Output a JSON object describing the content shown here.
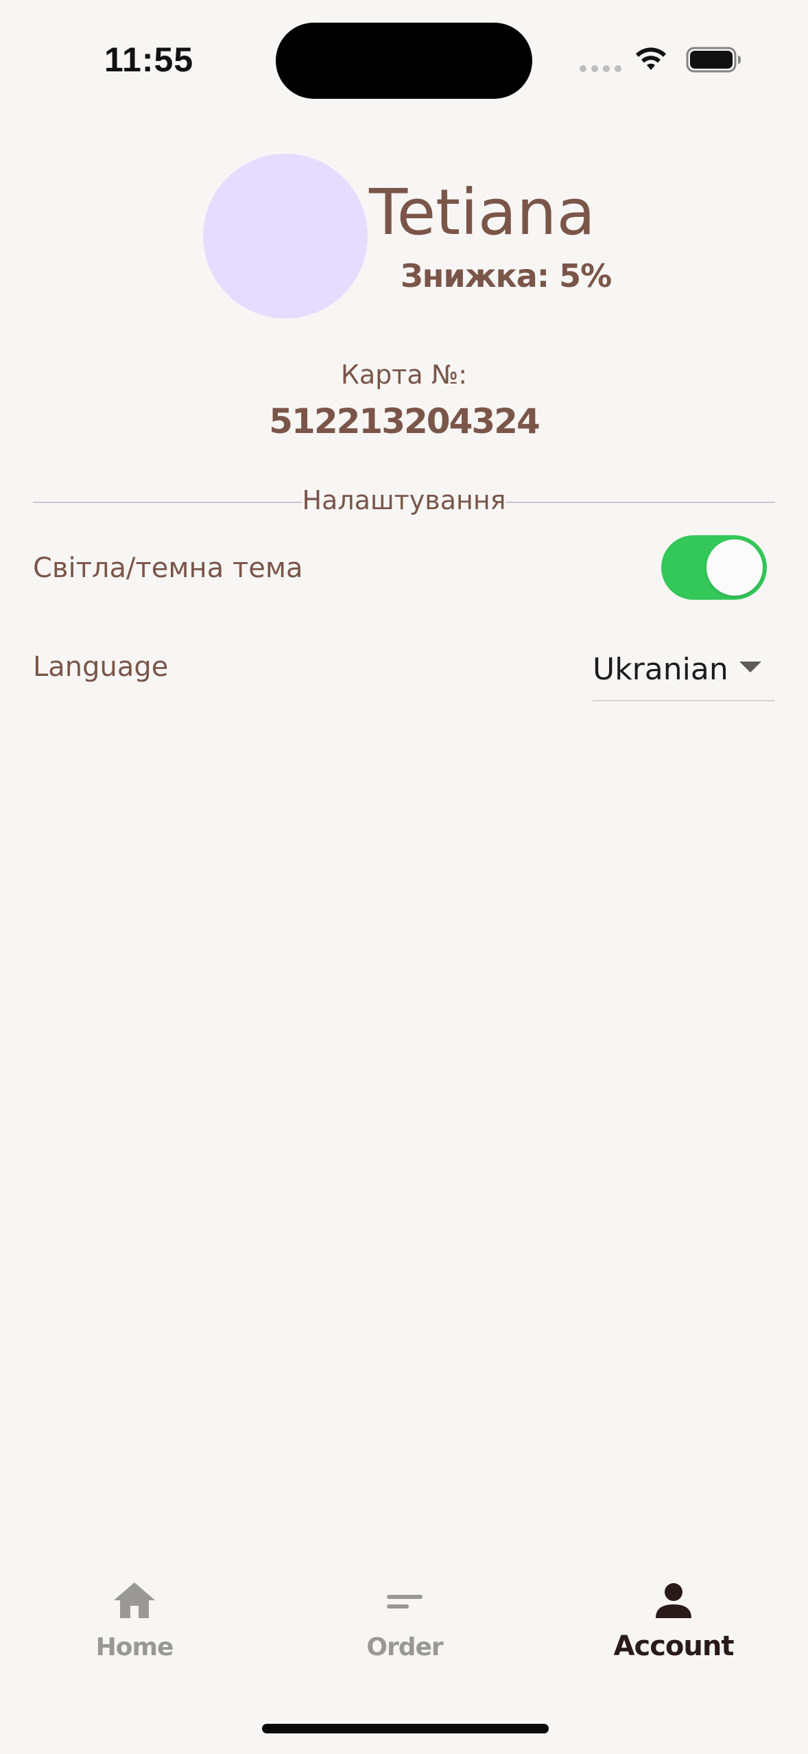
{
  "status_bar": {
    "time": "11:55"
  },
  "profile": {
    "name": "Tetiana",
    "discount": "Знижка: 5%",
    "avatar_color": "#e6dcff",
    "card_label": "Карта №:",
    "card_number": "512213204324"
  },
  "settings": {
    "section_title": "Налаштування",
    "theme_label": "Світла/темна тема",
    "theme_toggle_on": true,
    "language_label": "Language",
    "language_value": "Ukranian"
  },
  "bottom_nav": {
    "items": [
      {
        "label": "Home",
        "icon": "home-icon",
        "active": false
      },
      {
        "label": "Order",
        "icon": "order-icon",
        "active": false
      },
      {
        "label": "Account",
        "icon": "account-icon",
        "active": true
      }
    ]
  },
  "colors": {
    "accent_text": "#7a5548",
    "toggle_on": "#34c759",
    "background": "#f7f6f5"
  }
}
